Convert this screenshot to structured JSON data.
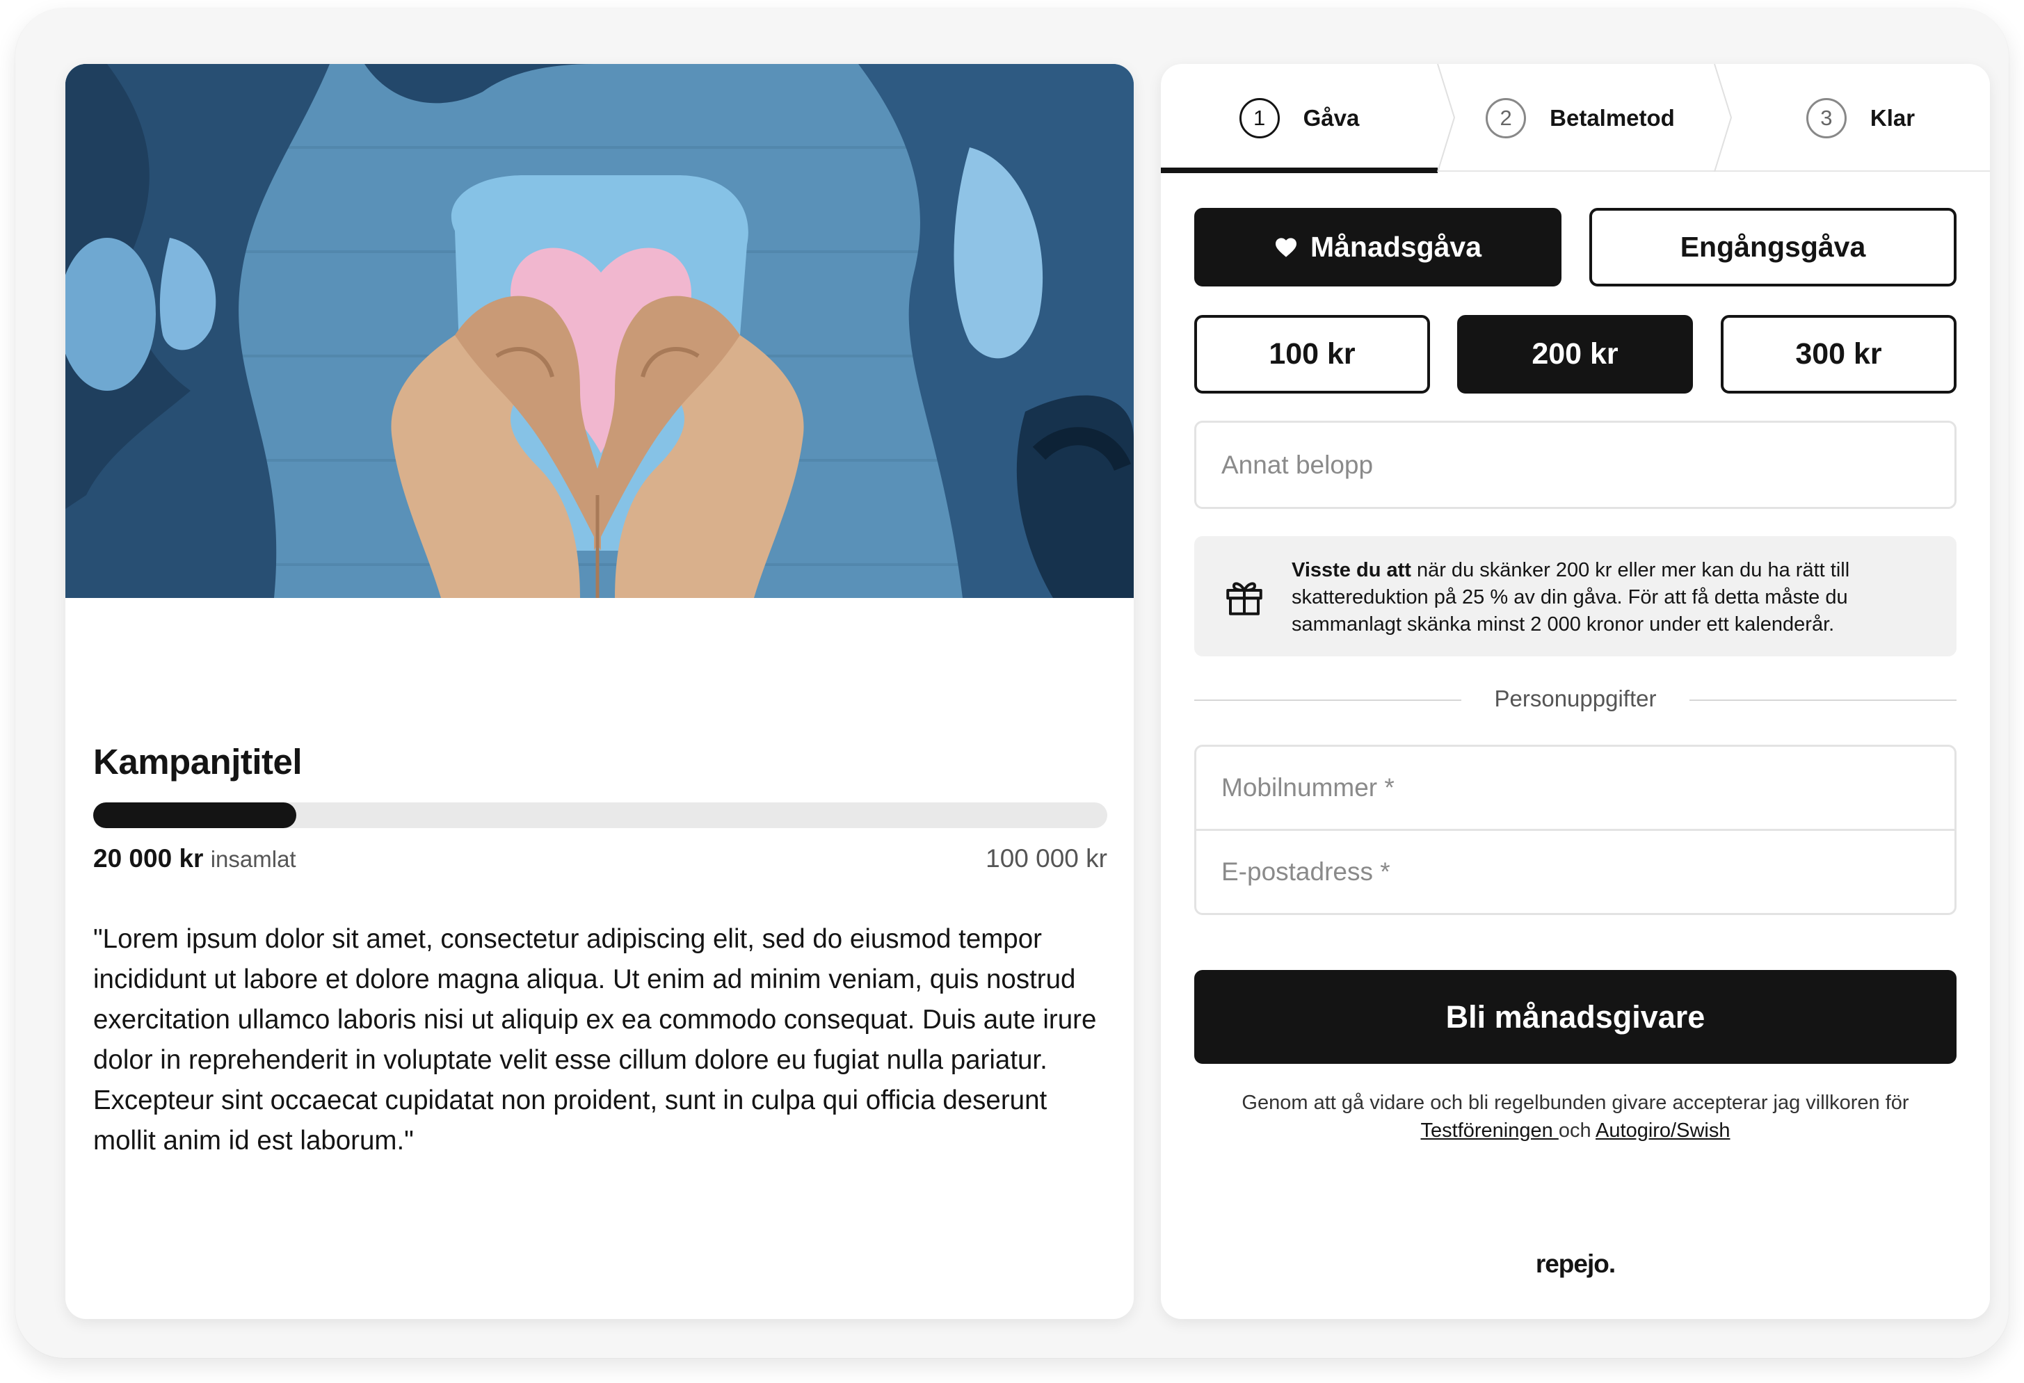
{
  "campaign": {
    "title": "Kampanjtitel",
    "raised_amount": "20 000 kr",
    "raised_label": "insamlat",
    "goal": "100 000 kr",
    "progress_fraction": 0.2,
    "description": "\"Lorem ipsum dolor sit amet, consectetur adipiscing elit, sed do eiusmod tempor incididunt ut labore et dolore magna aliqua. Ut enim ad minim veniam, quis nostrud exercitation ullamco laboris nisi ut aliquip ex ea commodo consequat. Duis aute irure dolor in reprehenderit in voluptate velit esse cillum dolore eu fugiat nulla pariatur. Excepteur sint occaecat cupidatat non proident, sunt in culpa qui officia deserunt mollit anim id est laborum.\""
  },
  "steps": [
    {
      "number": "1",
      "label": "Gåva",
      "active": true
    },
    {
      "number": "2",
      "label": "Betalmetod",
      "active": false
    },
    {
      "number": "3",
      "label": "Klar",
      "active": false
    }
  ],
  "gift_type": {
    "monthly": "Månadsgåva",
    "one_time": "Engångsgåva",
    "selected": "monthly"
  },
  "amounts": {
    "options": [
      "100 kr",
      "200 kr",
      "300 kr"
    ],
    "selected": "200 kr",
    "other_placeholder": "Annat belopp"
  },
  "info": {
    "bold": "Visste du att",
    "text": " när du skänker 200 kr eller mer kan du ha rätt till skattereduktion på 25 % av din gåva. För att få detta måste du sammanlagt skänka minst 2 000 kronor under ett kalenderår."
  },
  "personal": {
    "section_label": "Personuppgifter",
    "mobile_placeholder": "Mobilnummer *",
    "email_placeholder": "E-postadress *"
  },
  "cta_label": "Bli månadsgivare",
  "terms": {
    "text": "Genom att gå vidare och bli regelbunden givare accepterar jag villkoren för",
    "link1": "Testföreningen ",
    "and": " och ",
    "link2": "Autogiro/Swish"
  },
  "brand": "repejo.",
  "colors": {
    "dark": "#141414",
    "track": "#e9e9e9",
    "info_bg": "#f1f1f1"
  }
}
